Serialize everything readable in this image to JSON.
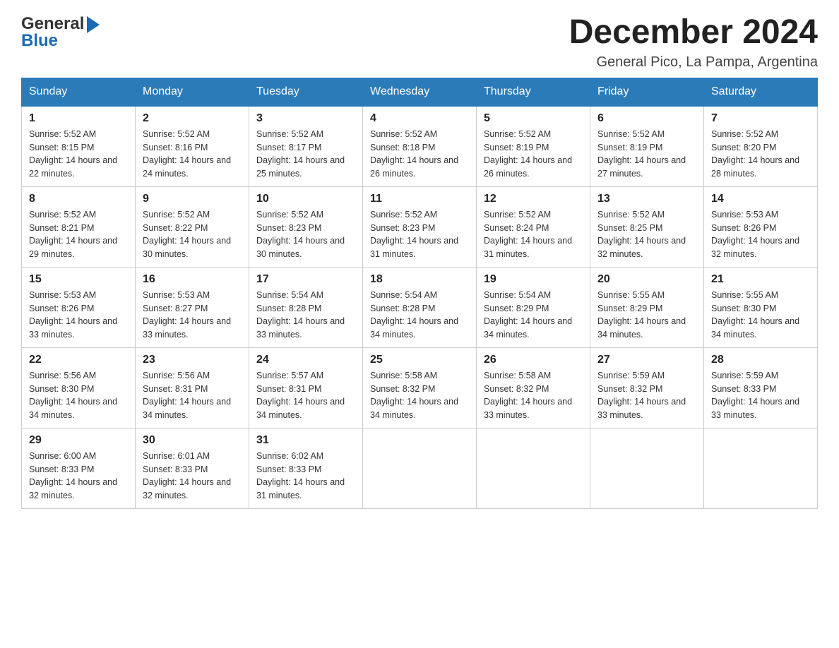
{
  "header": {
    "logo_general": "General",
    "logo_blue": "Blue",
    "month_title": "December 2024",
    "location": "General Pico, La Pampa, Argentina"
  },
  "weekdays": [
    "Sunday",
    "Monday",
    "Tuesday",
    "Wednesday",
    "Thursday",
    "Friday",
    "Saturday"
  ],
  "weeks": [
    [
      {
        "day": "1",
        "sunrise": "5:52 AM",
        "sunset": "8:15 PM",
        "daylight": "14 hours and 22 minutes."
      },
      {
        "day": "2",
        "sunrise": "5:52 AM",
        "sunset": "8:16 PM",
        "daylight": "14 hours and 24 minutes."
      },
      {
        "day": "3",
        "sunrise": "5:52 AM",
        "sunset": "8:17 PM",
        "daylight": "14 hours and 25 minutes."
      },
      {
        "day": "4",
        "sunrise": "5:52 AM",
        "sunset": "8:18 PM",
        "daylight": "14 hours and 26 minutes."
      },
      {
        "day": "5",
        "sunrise": "5:52 AM",
        "sunset": "8:19 PM",
        "daylight": "14 hours and 26 minutes."
      },
      {
        "day": "6",
        "sunrise": "5:52 AM",
        "sunset": "8:19 PM",
        "daylight": "14 hours and 27 minutes."
      },
      {
        "day": "7",
        "sunrise": "5:52 AM",
        "sunset": "8:20 PM",
        "daylight": "14 hours and 28 minutes."
      }
    ],
    [
      {
        "day": "8",
        "sunrise": "5:52 AM",
        "sunset": "8:21 PM",
        "daylight": "14 hours and 29 minutes."
      },
      {
        "day": "9",
        "sunrise": "5:52 AM",
        "sunset": "8:22 PM",
        "daylight": "14 hours and 30 minutes."
      },
      {
        "day": "10",
        "sunrise": "5:52 AM",
        "sunset": "8:23 PM",
        "daylight": "14 hours and 30 minutes."
      },
      {
        "day": "11",
        "sunrise": "5:52 AM",
        "sunset": "8:23 PM",
        "daylight": "14 hours and 31 minutes."
      },
      {
        "day": "12",
        "sunrise": "5:52 AM",
        "sunset": "8:24 PM",
        "daylight": "14 hours and 31 minutes."
      },
      {
        "day": "13",
        "sunrise": "5:52 AM",
        "sunset": "8:25 PM",
        "daylight": "14 hours and 32 minutes."
      },
      {
        "day": "14",
        "sunrise": "5:53 AM",
        "sunset": "8:26 PM",
        "daylight": "14 hours and 32 minutes."
      }
    ],
    [
      {
        "day": "15",
        "sunrise": "5:53 AM",
        "sunset": "8:26 PM",
        "daylight": "14 hours and 33 minutes."
      },
      {
        "day": "16",
        "sunrise": "5:53 AM",
        "sunset": "8:27 PM",
        "daylight": "14 hours and 33 minutes."
      },
      {
        "day": "17",
        "sunrise": "5:54 AM",
        "sunset": "8:28 PM",
        "daylight": "14 hours and 33 minutes."
      },
      {
        "day": "18",
        "sunrise": "5:54 AM",
        "sunset": "8:28 PM",
        "daylight": "14 hours and 34 minutes."
      },
      {
        "day": "19",
        "sunrise": "5:54 AM",
        "sunset": "8:29 PM",
        "daylight": "14 hours and 34 minutes."
      },
      {
        "day": "20",
        "sunrise": "5:55 AM",
        "sunset": "8:29 PM",
        "daylight": "14 hours and 34 minutes."
      },
      {
        "day": "21",
        "sunrise": "5:55 AM",
        "sunset": "8:30 PM",
        "daylight": "14 hours and 34 minutes."
      }
    ],
    [
      {
        "day": "22",
        "sunrise": "5:56 AM",
        "sunset": "8:30 PM",
        "daylight": "14 hours and 34 minutes."
      },
      {
        "day": "23",
        "sunrise": "5:56 AM",
        "sunset": "8:31 PM",
        "daylight": "14 hours and 34 minutes."
      },
      {
        "day": "24",
        "sunrise": "5:57 AM",
        "sunset": "8:31 PM",
        "daylight": "14 hours and 34 minutes."
      },
      {
        "day": "25",
        "sunrise": "5:58 AM",
        "sunset": "8:32 PM",
        "daylight": "14 hours and 34 minutes."
      },
      {
        "day": "26",
        "sunrise": "5:58 AM",
        "sunset": "8:32 PM",
        "daylight": "14 hours and 33 minutes."
      },
      {
        "day": "27",
        "sunrise": "5:59 AM",
        "sunset": "8:32 PM",
        "daylight": "14 hours and 33 minutes."
      },
      {
        "day": "28",
        "sunrise": "5:59 AM",
        "sunset": "8:33 PM",
        "daylight": "14 hours and 33 minutes."
      }
    ],
    [
      {
        "day": "29",
        "sunrise": "6:00 AM",
        "sunset": "8:33 PM",
        "daylight": "14 hours and 32 minutes."
      },
      {
        "day": "30",
        "sunrise": "6:01 AM",
        "sunset": "8:33 PM",
        "daylight": "14 hours and 32 minutes."
      },
      {
        "day": "31",
        "sunrise": "6:02 AM",
        "sunset": "8:33 PM",
        "daylight": "14 hours and 31 minutes."
      },
      null,
      null,
      null,
      null
    ]
  ],
  "labels": {
    "sunrise_prefix": "Sunrise: ",
    "sunset_prefix": "Sunset: ",
    "daylight_prefix": "Daylight: "
  }
}
